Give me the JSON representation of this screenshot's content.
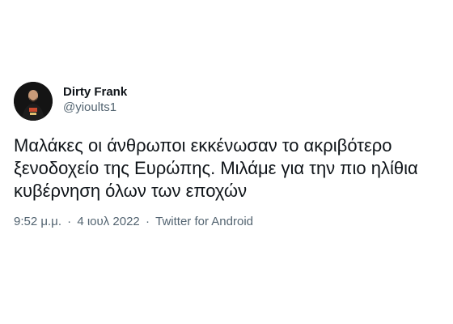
{
  "author": {
    "display_name": "Dirty Frank",
    "handle": "@yioults1",
    "avatar_icon": "user-avatar-photo"
  },
  "tweet": {
    "lines": [
      "Μαλάκες οι άνθρωποι εκκένωσαν το ακριβότερο",
      "ξενοδοχείο της Ευρώπης. Μιλάμε για την πιο ηλίθια",
      "κυβέρνηση όλων των εποχών"
    ]
  },
  "meta": {
    "time": "9:52 μ.μ.",
    "separator": "·",
    "date": "4 ιουλ 2022",
    "source": "Twitter for Android"
  },
  "colors": {
    "text_primary": "#0f1419",
    "text_secondary": "#536471",
    "background": "#ffffff"
  }
}
